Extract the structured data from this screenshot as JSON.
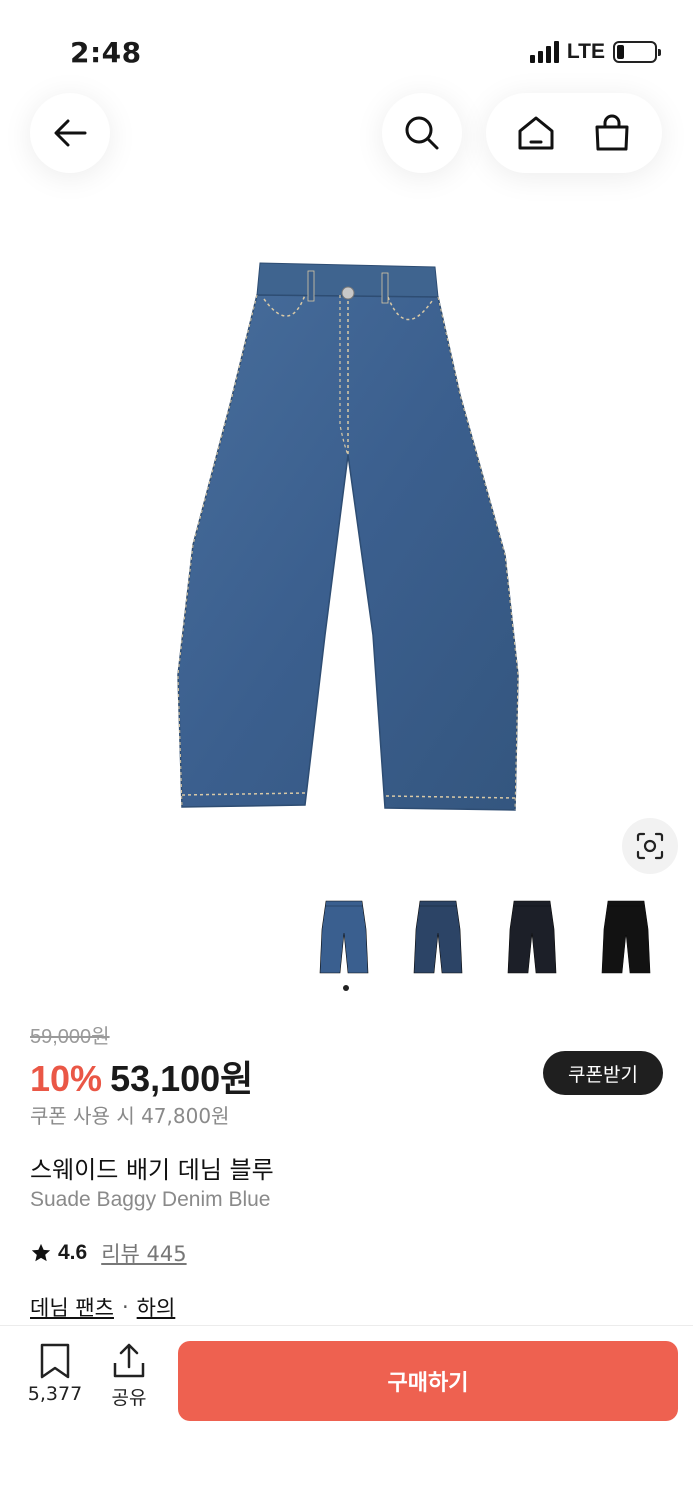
{
  "status_bar": {
    "time": "2:48",
    "network": "LTE"
  },
  "nav": {
    "back_icon": "arrow-left-icon",
    "search_icon": "search-icon",
    "home_icon": "home-icon",
    "bag_icon": "shopping-bag-icon"
  },
  "product": {
    "original_price": "59,000원",
    "discount": "10%",
    "price": "53,100원",
    "coupon_price": "쿠폰 사용 시 47,800원",
    "coupon_button": "쿠폰받기",
    "title_ko": "스웨이드 배기 데님 블루",
    "title_en": "Suade Baggy Denim Blue",
    "rating": "4.6",
    "review": "리뷰 445",
    "categories": [
      "데님 팬츠",
      "하의"
    ],
    "category_separator": "·",
    "thumbnails": [
      {
        "color": "#3a5f8f",
        "icon": "jeans-thumbnail-blue"
      },
      {
        "color": "#2c4466",
        "icon": "jeans-thumbnail-navy"
      },
      {
        "color": "#1c1f28",
        "icon": "jeans-thumbnail-black"
      },
      {
        "color": "#121212",
        "icon": "jeans-thumbnail-jet-black"
      }
    ],
    "selected_thumbnail": 1
  },
  "bottom_bar": {
    "save_count": "5,377",
    "share_label": "공유",
    "buy_label": "구매하기"
  },
  "colors": {
    "accent": "#ea5746",
    "buy_button": "#ee6150",
    "denim": "#3b5f8e"
  }
}
